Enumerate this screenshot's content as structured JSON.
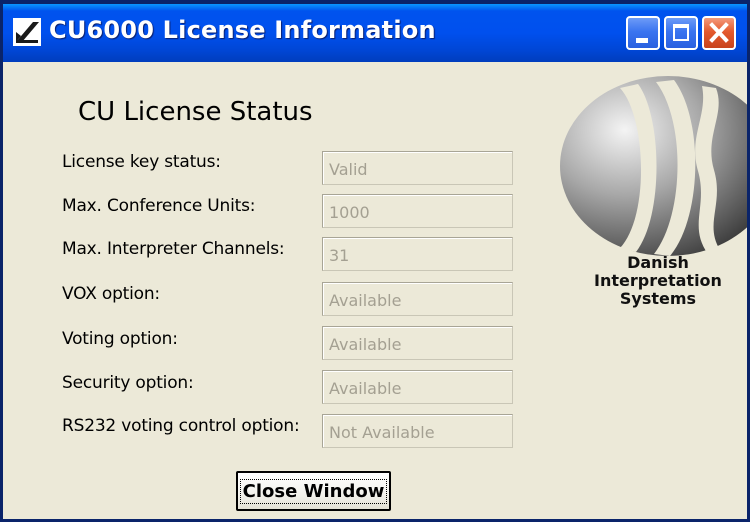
{
  "window": {
    "title": "CU6000 License Information"
  },
  "heading": "CU License Status",
  "fields": [
    {
      "label": "License key status:",
      "value": "Valid"
    },
    {
      "label": "Max. Conference Units:",
      "value": "1000"
    },
    {
      "label": "Max. Interpreter Channels:",
      "value": "31"
    },
    {
      "label": "VOX option:",
      "value": "Available"
    },
    {
      "label": "Voting option:",
      "value": "Available"
    },
    {
      "label": "Security option:",
      "value": "Available"
    },
    {
      "label": "RS232 voting control option:",
      "value": "Not Available"
    }
  ],
  "logo": {
    "line1": "Danish",
    "line2": "Interpretation",
    "line3": "Systems"
  },
  "buttons": {
    "close_window": "Close Window"
  }
}
